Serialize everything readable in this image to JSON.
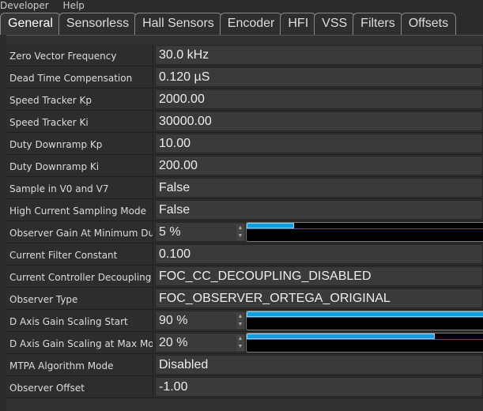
{
  "menu": [
    "Developer",
    "Help"
  ],
  "tabs": [
    {
      "label": "General",
      "active": true
    },
    {
      "label": "Sensorless"
    },
    {
      "label": "Hall Sensors"
    },
    {
      "label": "Encoder"
    },
    {
      "label": "HFI"
    },
    {
      "label": "VSS"
    },
    {
      "label": "Filters"
    },
    {
      "label": "Offsets"
    }
  ],
  "rows": [
    {
      "label": "Zero Vector Frequency",
      "value": "30.0 kHz",
      "type": "text"
    },
    {
      "label": "Dead Time Compensation",
      "value": "0.120 µS",
      "type": "text"
    },
    {
      "label": "Speed Tracker Kp",
      "value": "2000.00",
      "type": "text"
    },
    {
      "label": "Speed Tracker Ki",
      "value": "30000.00",
      "type": "text"
    },
    {
      "label": "Duty Downramp Kp",
      "value": "10.00",
      "type": "text"
    },
    {
      "label": "Duty Downramp Ki",
      "value": "200.00",
      "type": "text"
    },
    {
      "label": "Sample in V0 and V7",
      "value": "False",
      "type": "combo"
    },
    {
      "label": "High Current Sampling Mode",
      "value": "False",
      "type": "combo"
    },
    {
      "label": "Observer Gain At Minimum Duty",
      "value": "5 %",
      "type": "slider",
      "percent": 5
    },
    {
      "label": "Current Filter Constant",
      "value": "0.100",
      "type": "text"
    },
    {
      "label": "Current Controller Decoupling",
      "value": "FOC_CC_DECOUPLING_DISABLED",
      "type": "combo"
    },
    {
      "label": "Observer Type",
      "value": "FOC_OBSERVER_ORTEGA_ORIGINAL",
      "type": "combo"
    },
    {
      "label": "D Axis Gain Scaling Start",
      "value": "90 %",
      "type": "slider",
      "percent": 90
    },
    {
      "label": "D Axis Gain Scaling at Max Mod",
      "value": "20 %",
      "type": "slider",
      "percent": 20
    },
    {
      "label": "MTPA Algorithm Mode",
      "value": "Disabled",
      "type": "combo"
    },
    {
      "label": "Observer Offset",
      "value": "-1.00",
      "type": "text"
    }
  ],
  "colors": {
    "accent": "#0fa0e0"
  }
}
